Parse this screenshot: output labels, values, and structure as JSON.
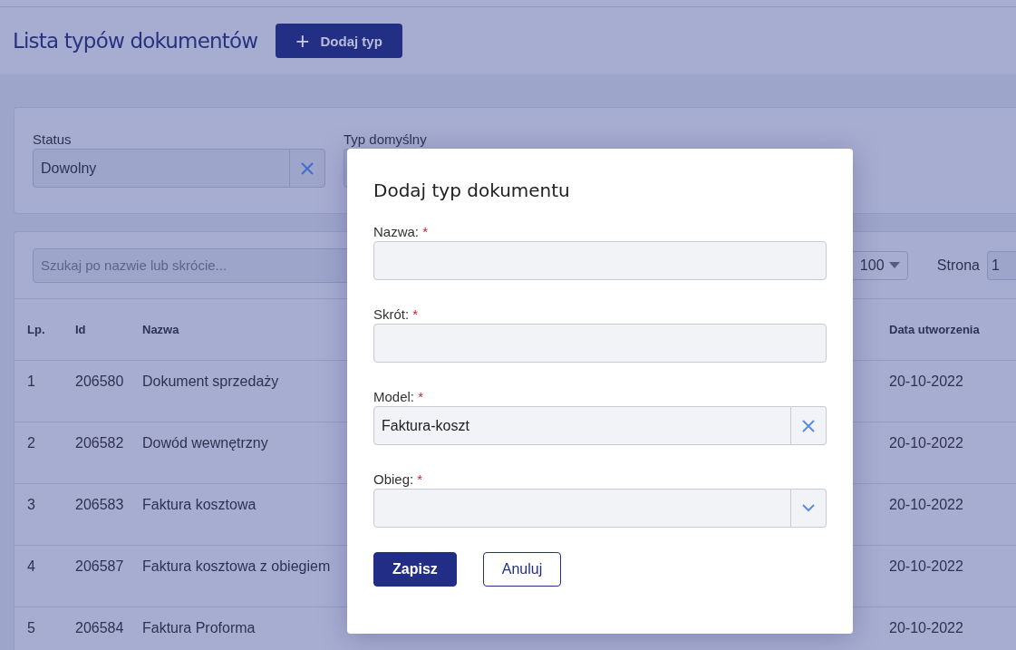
{
  "page_title": "Lista typów dokumentów",
  "add_button": {
    "icon": "+",
    "label": "Dodaj typ"
  },
  "filters": [
    {
      "label": "Status",
      "value": "Dowolny",
      "clearable": true
    },
    {
      "label": "Typ domyślny"
    }
  ],
  "search": {
    "placeholder": "Szukaj po nazwie lub skrócie..."
  },
  "page_size": "100",
  "page_label": "Strona",
  "page_number": "1",
  "table": {
    "columns": [
      "Lp.",
      "Id",
      "Nazwa",
      "Data utworzenia"
    ],
    "rows": [
      [
        "1",
        "206580",
        "Dokument sprzedaży",
        "20-10-2022"
      ],
      [
        "2",
        "206582",
        "Dowód wewnętrzny",
        "20-10-2022"
      ],
      [
        "3",
        "206583",
        "Faktura kosztowa",
        "20-10-2022"
      ],
      [
        "4",
        "206587",
        "Faktura kosztowa z obiegiem",
        "20-10-2022"
      ],
      [
        "5",
        "206584",
        "Faktura Proforma",
        "20-10-2022"
      ]
    ]
  },
  "dialog": {
    "title": "Dodaj typ dokumentu",
    "fields": [
      {
        "label": "Nazwa:",
        "required_mark": "*",
        "kind": "text"
      },
      {
        "label": "Skrót:",
        "required_mark": "*",
        "kind": "text"
      },
      {
        "label": "Model:",
        "required_mark": "*",
        "kind": "clearable",
        "value": "Faktura-koszt"
      },
      {
        "label": "Obieg:",
        "required_mark": "*",
        "kind": "dropdown"
      }
    ],
    "buttons": [
      {
        "label": "Zapisz",
        "primary": true
      },
      {
        "label": "Anuluj",
        "primary": false
      }
    ]
  }
}
